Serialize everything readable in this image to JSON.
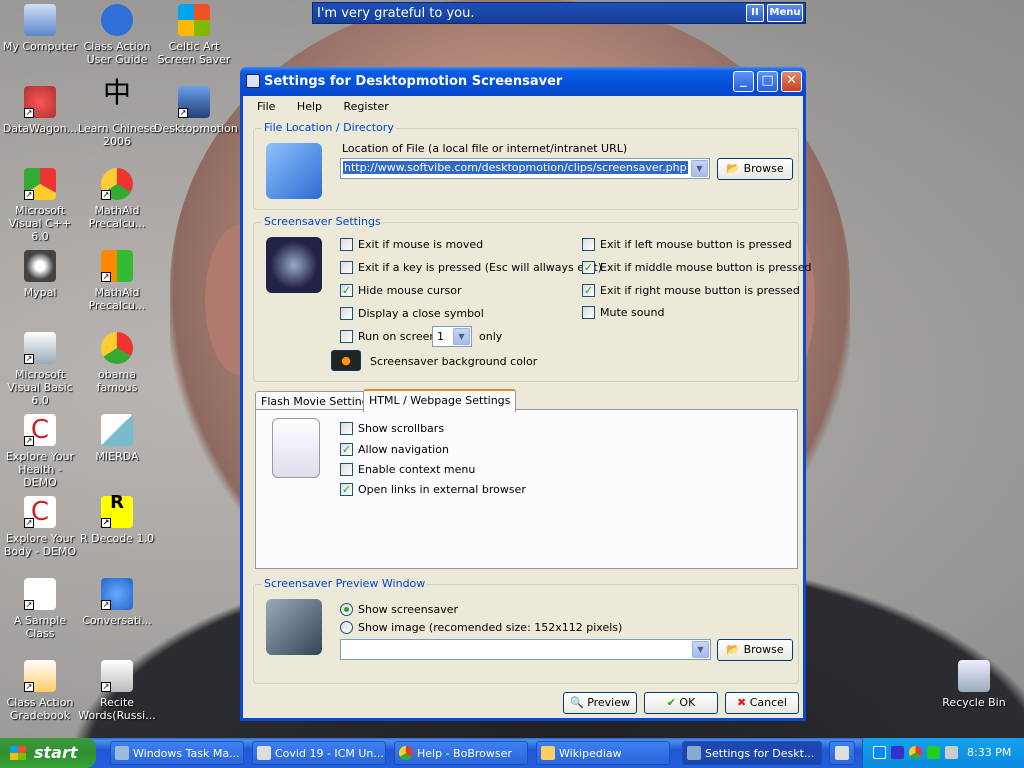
{
  "topbar": {
    "message": "I'm very grateful to you.",
    "pause_label": "II",
    "menu_label": "Menu"
  },
  "desktop_icons": [
    {
      "label": "My Computer"
    },
    {
      "label": "Class Action User Guide"
    },
    {
      "label": "Celtic Art Screen Saver"
    },
    {
      "label": "DataWagon..."
    },
    {
      "label": "Learn Chinese 2006"
    },
    {
      "label": "Desktopmotion"
    },
    {
      "label": "Microsoft Visual C++ 6.0"
    },
    {
      "label": "MathAid Precalcu..."
    },
    {
      "label": "Mypal"
    },
    {
      "label": "MathAid Precalcu..."
    },
    {
      "label": "Microsoft Visual Basic 6.0"
    },
    {
      "label": "obama famous"
    },
    {
      "label": "Explore Your Health - DEMO"
    },
    {
      "label": "MIERDA"
    },
    {
      "label": "Explore Your Body - DEMO"
    },
    {
      "label": "R Decode 1.0"
    },
    {
      "label": "A Sample Class"
    },
    {
      "label": "Conversati..."
    },
    {
      "label": "Class Action Gradebook"
    },
    {
      "label": "Recite Words(Russi..."
    },
    {
      "label": "Recycle Bin"
    }
  ],
  "window": {
    "title": "Settings for Desktopmotion Screensaver",
    "menu": [
      "File",
      "Help",
      "Register"
    ],
    "file_location": {
      "group_label": "File Location / Directory",
      "field_label": "Location of File (a local file or internet/intranet URL)",
      "url_value": "http://www.softvibe.com/desktopmotion/clips/screensaver.php",
      "browse_label": "Browse"
    },
    "screensaver_settings": {
      "group_label": "Screensaver Settings",
      "left_options": [
        {
          "label": "Exit if mouse is moved",
          "checked": false
        },
        {
          "label": "Exit if a key is pressed (Esc will allways exit)",
          "checked": false
        },
        {
          "label": "Hide mouse cursor",
          "checked": true
        },
        {
          "label": "Display a close symbol",
          "checked": false
        }
      ],
      "right_options": [
        {
          "label": "Exit if left mouse button is pressed",
          "checked": false
        },
        {
          "label": "Exit if middle mouse button is pressed",
          "checked": true
        },
        {
          "label": "Exit if right mouse button is pressed",
          "checked": true
        },
        {
          "label": "Mute sound",
          "checked": false
        }
      ],
      "run_on_screen_label": "Run on screen",
      "run_on_screen_value": "1",
      "run_on_screen_suffix": "only",
      "bg_color_label": "Screensaver background color"
    },
    "tabs": [
      "Flash Movie Settings",
      "HTML / Webpage Settings"
    ],
    "active_tab": "HTML / Webpage Settings",
    "html_options": [
      {
        "label": "Show scrollbars",
        "checked": false
      },
      {
        "label": "Allow navigation",
        "checked": true
      },
      {
        "label": "Enable context menu",
        "checked": false
      },
      {
        "label": "Open links in external browser",
        "checked": true
      }
    ],
    "preview": {
      "group_label": "Screensaver Preview Window",
      "opt1": "Show screensaver",
      "opt2": "Show image (recomended size: 152x112 pixels)",
      "selected": "Show screensaver",
      "browse_label": "Browse"
    },
    "buttons": {
      "preview": "Preview",
      "ok": "OK",
      "cancel": "Cancel"
    }
  },
  "taskbar": {
    "start_label": "start",
    "tasks": [
      "Windows Task Ma...",
      "Covid 19 - ICM Un...",
      "Help - BoBrowser",
      "Wikipediaw",
      "Settings for Deskt..."
    ],
    "clock": "8:33 PM"
  }
}
